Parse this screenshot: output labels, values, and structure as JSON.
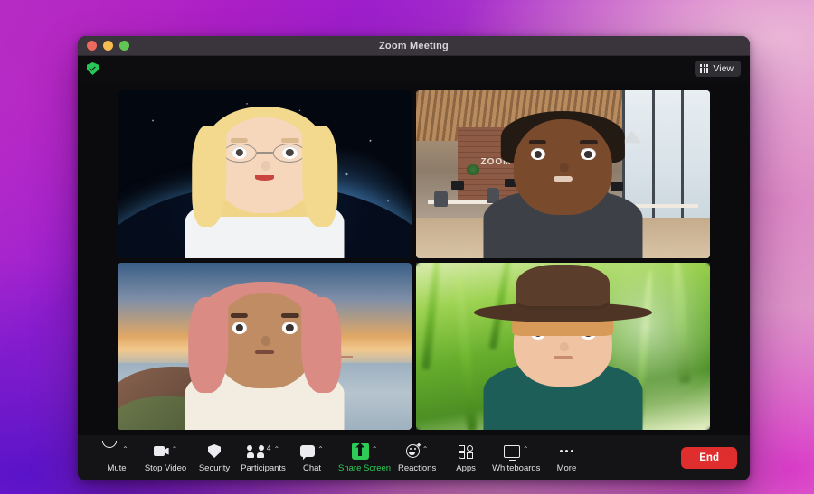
{
  "window": {
    "title": "Zoom Meeting",
    "traffic_lights": [
      "close",
      "minimize",
      "maximize"
    ],
    "encryption_icon": "shield-check-icon",
    "view_button": {
      "label": "View",
      "icon": "grid-icon"
    }
  },
  "gallery": {
    "participants": [
      {
        "position": "top-left",
        "background": "outer-space-earth",
        "avatar": "blonde-woman-with-glasses",
        "active_speaker": false
      },
      {
        "position": "top-right",
        "background": "zoom-office-brick-wall",
        "background_sign_text": "ZOOM",
        "avatar": "man-dark-skin-dark-sweater",
        "active_speaker": false
      },
      {
        "position": "bottom-left",
        "background": "golden-gate-bridge-sunset",
        "avatar": "woman-pink-hair-white-sweater",
        "active_speaker": false
      },
      {
        "position": "bottom-right",
        "background": "green-grass-blades",
        "avatar": "boy-brown-fedora-teal-jacket",
        "active_speaker": true
      }
    ]
  },
  "toolbar": {
    "items": [
      {
        "label": "Mute",
        "icon": "microphone-icon",
        "caret": "⌃",
        "active": false
      },
      {
        "label": "Stop Video",
        "icon": "video-camera-icon",
        "caret": "⌃",
        "active": false
      },
      {
        "label": "Security",
        "icon": "shield-icon",
        "caret": "",
        "active": false
      },
      {
        "label": "Participants",
        "icon": "people-icon",
        "caret": "⌃",
        "active": false,
        "count": "4"
      },
      {
        "label": "Chat",
        "icon": "chat-bubble-icon",
        "caret": "⌃",
        "active": false
      },
      {
        "label": "Share Screen",
        "icon": "share-screen-icon",
        "caret": "⌃",
        "active": true
      },
      {
        "label": "Reactions",
        "icon": "smiley-icon",
        "caret": "⌃",
        "active": false
      },
      {
        "label": "Apps",
        "icon": "apps-icon",
        "caret": "",
        "active": false
      },
      {
        "label": "Whiteboards",
        "icon": "whiteboard-icon",
        "caret": "⌃",
        "active": false
      },
      {
        "label": "More",
        "icon": "ellipsis-icon",
        "caret": "",
        "active": false
      }
    ],
    "end_button": {
      "label": "End",
      "color": "#e02d2d"
    }
  },
  "colors": {
    "accent_green": "#2ecc57",
    "end_red": "#e02d2d",
    "window_chrome": "#3a343d",
    "toolbar_bg": "#141417",
    "gallery_bg": "#0b0b0d"
  }
}
